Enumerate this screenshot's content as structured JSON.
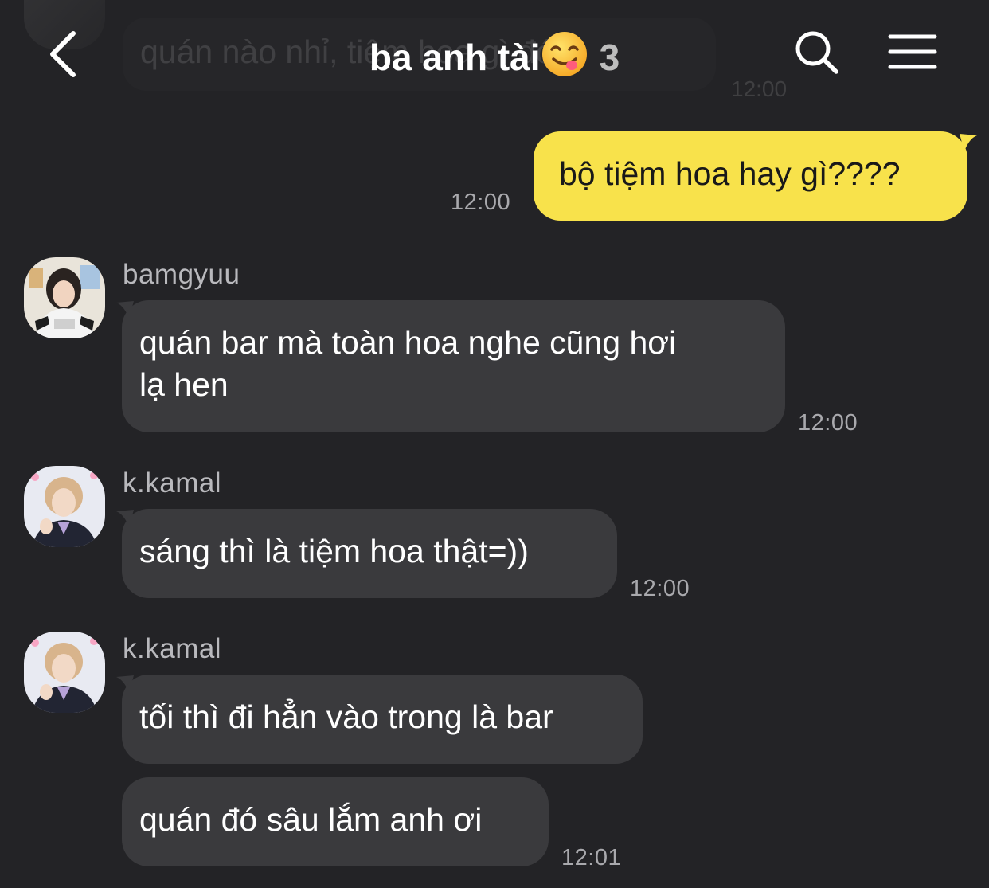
{
  "header": {
    "title": "ba anh tài",
    "title_emoji": "yum-face-emoji",
    "member_count": "3"
  },
  "ghost_message": {
    "text": "quán nào nhỉ, tiệm hoa gì đó",
    "time": "12:00"
  },
  "messages": [
    {
      "direction": "out",
      "text": "bộ tiệm hoa hay gì????",
      "time": "12:00"
    },
    {
      "direction": "in",
      "sender": "bamgyuu",
      "lines": [
        "quán bar mà toàn hoa nghe cũng hơi",
        "lạ hen"
      ],
      "time": "12:00"
    },
    {
      "direction": "in",
      "sender": "k.kamal",
      "text": "sáng thì là tiệm hoa thật=))",
      "time": "12:00"
    },
    {
      "direction": "in",
      "sender": "k.kamal",
      "text": "tối thì đi hẳn vào trong là bar"
    },
    {
      "direction": "in",
      "text": "quán đó sâu lắm anh ơi",
      "time": "12:01"
    }
  ],
  "icons": {
    "back": "chevron-left-icon",
    "search": "search-icon",
    "menu": "hamburger-menu-icon"
  },
  "colors": {
    "background": "#232326",
    "incoming_bubble": "#3a3a3d",
    "outgoing_bubble": "#f8e24b",
    "time_text": "#a9a9ad"
  }
}
